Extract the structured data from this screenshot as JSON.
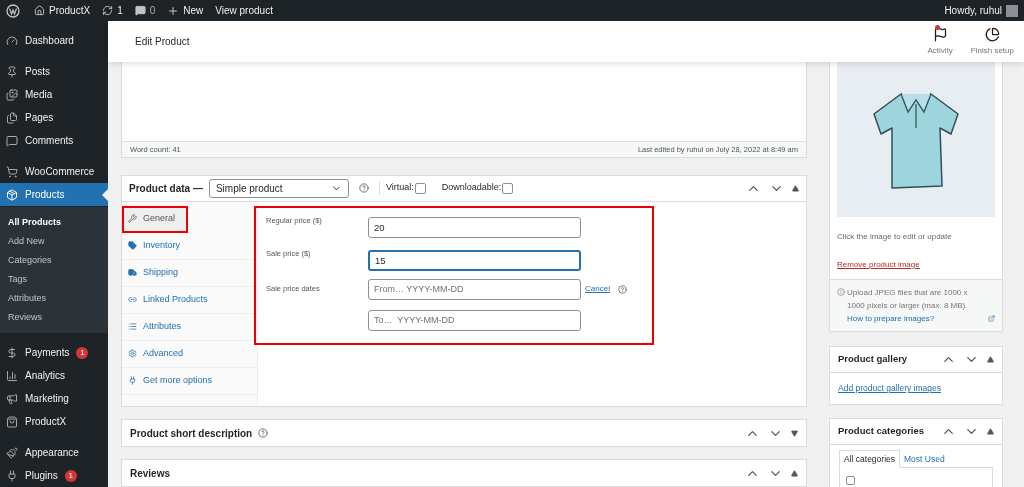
{
  "admin_bar": {
    "site": "ProductX",
    "updates": "1",
    "comments": "0",
    "new": "New",
    "view": "View product",
    "greeting": "Howdy, ruhul"
  },
  "sidebar": {
    "items": [
      {
        "label": "Dashboard",
        "selected": false
      },
      {
        "label": "Posts",
        "selected": false
      },
      {
        "label": "Media",
        "selected": false
      },
      {
        "label": "Pages",
        "selected": false
      },
      {
        "label": "Comments",
        "selected": false
      },
      {
        "label": "WooCommerce",
        "selected": false
      },
      {
        "label": "Products",
        "selected": true,
        "children": [
          {
            "label": "All Products",
            "selected": true
          },
          {
            "label": "Add New",
            "selected": false
          },
          {
            "label": "Categories",
            "selected": false
          },
          {
            "label": "Tags",
            "selected": false
          },
          {
            "label": "Attributes",
            "selected": false
          },
          {
            "label": "Reviews",
            "selected": false
          }
        ]
      },
      {
        "label": "Payments",
        "selected": false,
        "badge": "1"
      },
      {
        "label": "Analytics",
        "selected": false
      },
      {
        "label": "Marketing",
        "selected": false
      },
      {
        "label": "ProductX",
        "selected": false
      },
      {
        "label": "Appearance",
        "selected": false
      },
      {
        "label": "Plugins",
        "selected": false,
        "badge": "1"
      }
    ]
  },
  "header": {
    "title": "Edit Product",
    "actions": [
      {
        "label": "Activity",
        "dot": true
      },
      {
        "label": "Finish setup",
        "dot": false
      }
    ]
  },
  "editor": {
    "word_count": "Word count: 41",
    "last_edited": "Last edited by ruhul on July 28, 2022 at 8:49 am"
  },
  "product_data": {
    "title": "Product data —",
    "type": "Simple product",
    "virtual": {
      "label": "Virtual:",
      "checked": false
    },
    "downloadable": {
      "label": "Downloadable:",
      "checked": false
    },
    "tabs": [
      {
        "label": "General",
        "selected": true,
        "highlighted": true
      },
      {
        "label": "Inventory",
        "selected": false,
        "highlighted": false
      },
      {
        "label": "Shipping",
        "selected": false,
        "highlighted": false
      },
      {
        "label": "Linked Products",
        "selected": false,
        "highlighted": false
      },
      {
        "label": "Attributes",
        "selected": false,
        "highlighted": false
      },
      {
        "label": "Advanced",
        "selected": false,
        "highlighted": false
      },
      {
        "label": "Get more options",
        "selected": false,
        "highlighted": false
      }
    ],
    "fields_highlighted": true,
    "fields": [
      {
        "label": "Regular price ($)",
        "value": "20",
        "focused": false
      },
      {
        "label": "Sale price ($)",
        "value": "15",
        "focused": true
      }
    ],
    "dates": {
      "label": "Sale price dates",
      "from_placeholder": "From… YYYY-MM-DD",
      "to_placeholder": "To…  YYYY-MM-DD",
      "cancel": "Cancel"
    }
  },
  "panels": [
    {
      "title": "Product short description",
      "help": true,
      "expanded": false
    },
    {
      "title": "Reviews",
      "help": false,
      "expanded": true
    }
  ],
  "product_image": {
    "caption": "Click the image to edit or update",
    "remove": "Remove product image",
    "note": "Upload JPEG files that are 1000 x 1000 pixels or larger (max. 8 MB).",
    "note_link": "How to prepare images?"
  },
  "gallery": {
    "title": "Product gallery",
    "link": "Add product gallery images"
  },
  "categories": {
    "title": "Product categories",
    "tabs": [
      {
        "label": "All categories",
        "selected": true
      },
      {
        "label": "Most Used",
        "selected": false
      }
    ],
    "items": [
      {
        "checked": false
      }
    ]
  }
}
